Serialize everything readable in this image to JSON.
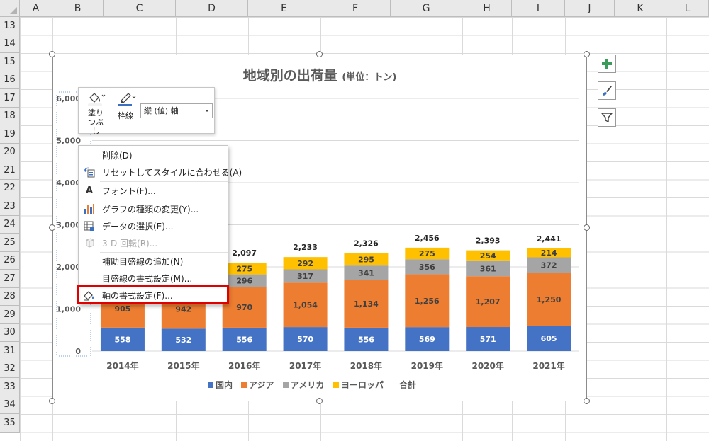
{
  "sheet": {
    "columns": [
      "A",
      "B",
      "C",
      "D",
      "E",
      "F",
      "G",
      "H",
      "I",
      "J",
      "K",
      "L"
    ],
    "rows": [
      "13",
      "14",
      "15",
      "16",
      "17",
      "18",
      "19",
      "20",
      "21",
      "22",
      "23",
      "24",
      "25",
      "26",
      "27",
      "28",
      "29",
      "30",
      "31",
      "32",
      "33",
      "34",
      "35"
    ]
  },
  "chart": {
    "title": "地域別の出荷量",
    "subtitle": "(単位：トン)"
  },
  "chart_data": {
    "type": "bar",
    "stacked": true,
    "categories": [
      "2014年",
      "2015年",
      "2016年",
      "2017年",
      "2018年",
      "2019年",
      "2020年",
      "2021年"
    ],
    "series": [
      {
        "name": "国内",
        "color": "#4472c4",
        "values": [
          558,
          532,
          556,
          570,
          556,
          569,
          571,
          605
        ]
      },
      {
        "name": "アジア",
        "color": "#ed7d31",
        "values": [
          905,
          942,
          970,
          1054,
          1134,
          1256,
          1207,
          1250
        ]
      },
      {
        "name": "アメリカ",
        "color": "#a5a5a5",
        "values": [
          null,
          null,
          296,
          317,
          341,
          356,
          361,
          372
        ]
      },
      {
        "name": "ヨーロッパ",
        "color": "#ffc000",
        "values": [
          null,
          null,
          275,
          292,
          295,
          275,
          254,
          214
        ]
      }
    ],
    "totals": {
      "name": "合計",
      "values": [
        null,
        null,
        "2,097",
        "2,233",
        "2,326",
        "2,456",
        "2,393",
        "2,441"
      ]
    },
    "value_labels": [
      [
        "558",
        "532",
        "556",
        "570",
        "556",
        "569",
        "571",
        "605"
      ],
      [
        "905",
        "942",
        "970",
        "1,054",
        "1,134",
        "1,256",
        "1,207",
        "1,250"
      ],
      [
        null,
        null,
        "296",
        "317",
        "341",
        "356",
        "361",
        "372"
      ],
      [
        null,
        null,
        "275",
        "292",
        "295",
        "275",
        "254",
        "214"
      ]
    ],
    "y_ticks": [
      "0",
      "1,000",
      "2,000",
      "3,000",
      "4,000",
      "5,000",
      "6,000"
    ],
    "ylim": [
      0,
      6000
    ],
    "grid": true,
    "legend_position": "bottom"
  },
  "mini_toolbar": {
    "fill_label": "塗りつぶし",
    "outline_label": "枠線",
    "element_select": "縦 (値) 軸"
  },
  "context_menu": {
    "items": [
      {
        "label": "削除(D)",
        "icon": "none",
        "disabled": false
      },
      {
        "label": "リセットしてスタイルに合わせる(A)",
        "icon": "reset-style-icon",
        "disabled": false
      },
      {
        "label": "フォント(F)...",
        "icon": "font-icon",
        "disabled": false
      },
      {
        "label": "グラフの種類の変更(Y)...",
        "icon": "chart-type-icon",
        "disabled": false
      },
      {
        "label": "データの選択(E)...",
        "icon": "select-data-icon",
        "disabled": false
      },
      {
        "label": "3-D 回転(R)...",
        "icon": "rotate-3d-icon",
        "disabled": true
      },
      {
        "label": "補助目盛線の追加(N)",
        "icon": "none",
        "disabled": false
      },
      {
        "label": "目盛線の書式設定(M)...",
        "icon": "none",
        "disabled": false
      },
      {
        "label": "軸の書式設定(F)...",
        "icon": "format-axis-icon",
        "disabled": false
      }
    ]
  },
  "highlight_color": "#e00000"
}
